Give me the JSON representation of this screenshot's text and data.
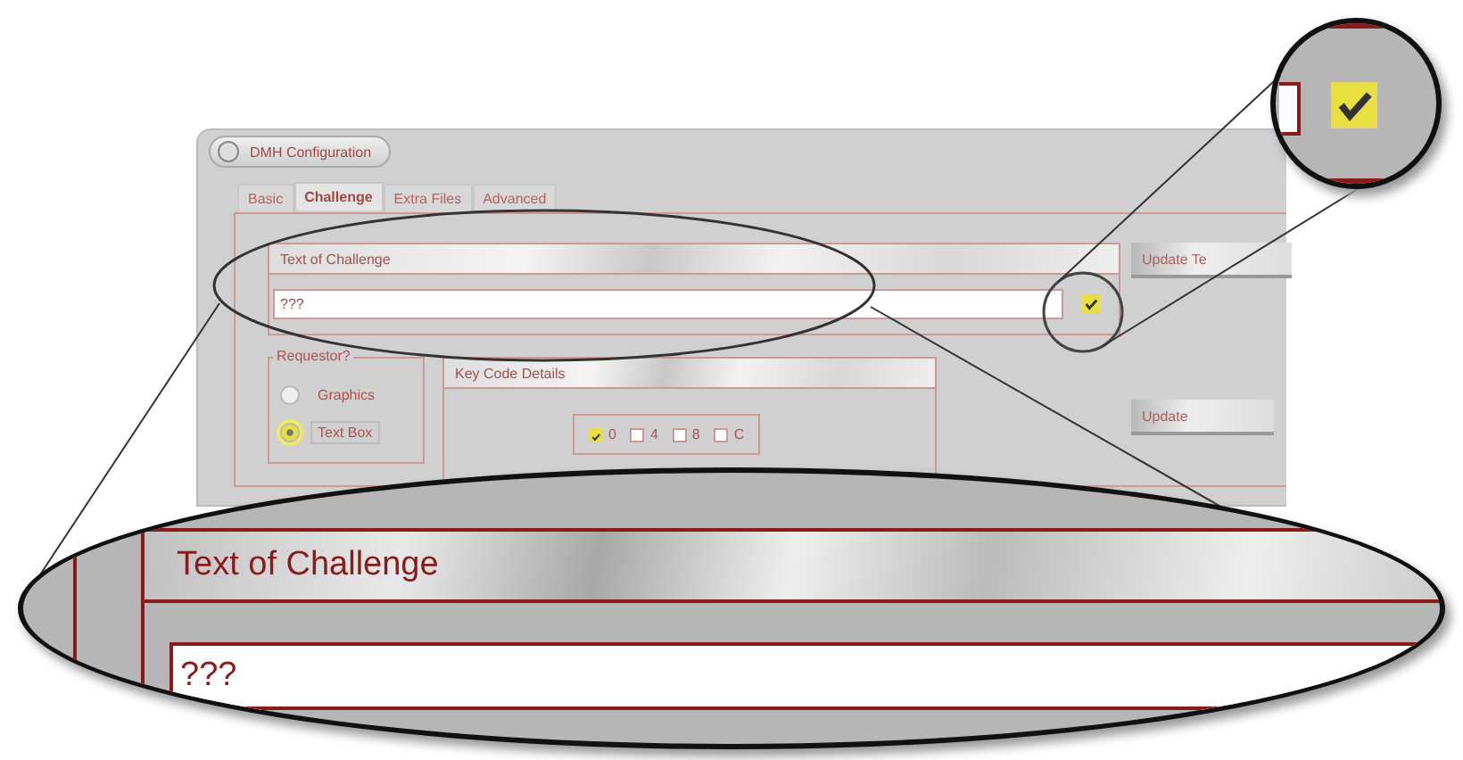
{
  "window": {
    "title": "DMH Configuration"
  },
  "tabs": [
    {
      "label": "Basic",
      "selected": false
    },
    {
      "label": "Challenge",
      "selected": true
    },
    {
      "label": "Extra Files",
      "selected": false
    },
    {
      "label": "Advanced",
      "selected": false
    }
  ],
  "challenge": {
    "title": "Text of Challenge",
    "value": "???",
    "checked": true
  },
  "buttons": [
    "Update Te",
    "Update"
  ],
  "requestor": {
    "title": "Requestor?",
    "options": [
      {
        "label": "Graphics",
        "selected": false
      },
      {
        "label": "Text Box",
        "selected": true
      }
    ]
  },
  "key_code": {
    "title": "Key Code Details",
    "keys": [
      {
        "label": "0",
        "checked": true
      },
      {
        "label": "4",
        "checked": false
      },
      {
        "label": "8",
        "checked": false
      },
      {
        "label": "C",
        "checked": false
      }
    ]
  },
  "magnifier_large": {
    "title": "Text of Challenge",
    "value": "???"
  },
  "magnifier_small": {
    "checked": true
  }
}
